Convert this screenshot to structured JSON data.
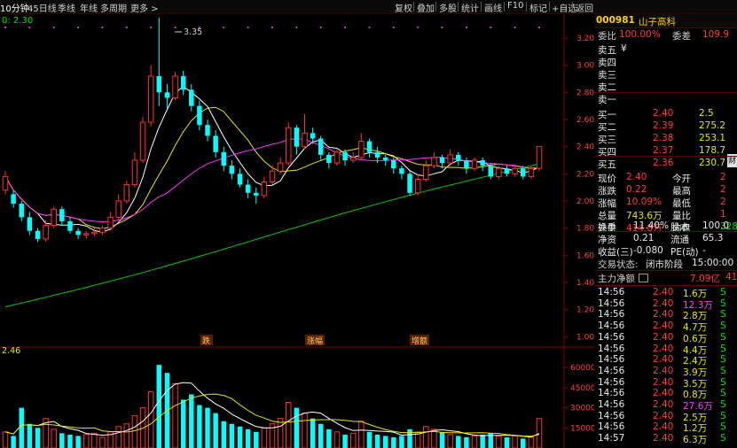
{
  "toolbar": {
    "period_label": "10分钟",
    "items": [
      "45日线",
      "季线",
      "年线",
      "多周期",
      "更多 >"
    ],
    "buttons": [
      "复权",
      "叠加",
      "多股",
      "统计",
      "画线",
      "F10",
      "标记",
      "+自选",
      "返回"
    ]
  },
  "chart": {
    "ma_label": "0: 2.30",
    "peak_label": "3.35",
    "price_ticks": [
      "3.20",
      "3.00",
      "2.80",
      "2.60",
      "2.40",
      "2.20",
      "2.00",
      "1.80",
      "1.60",
      "1.40",
      "1.20",
      "1.00"
    ],
    "volume_label": "2.46",
    "volume_ticks": [
      "60000",
      "45000",
      "30000",
      "15000"
    ],
    "event_tags": [
      "跌",
      "涨幅",
      "增额"
    ]
  },
  "quote": {
    "code": "000981",
    "name": "山子高科",
    "weibi_label": "委比",
    "weibi_value": "100.00%",
    "weicha_label": "委差",
    "weicha_value": "109.9",
    "sell_levels": [
      {
        "label": "卖五",
        "price": "¥",
        "vol": ""
      },
      {
        "label": "卖四",
        "price": "",
        "vol": ""
      },
      {
        "label": "卖三",
        "price": "",
        "vol": ""
      },
      {
        "label": "卖二",
        "price": "",
        "vol": ""
      },
      {
        "label": "卖一",
        "price": "",
        "vol": ""
      }
    ],
    "buy_levels": [
      {
        "label": "买一",
        "price": "2.40",
        "vol": "2.5"
      },
      {
        "label": "买二",
        "price": "2.39",
        "vol": "275.2"
      },
      {
        "label": "买三",
        "price": "2.38",
        "vol": "253.1"
      },
      {
        "label": "买四",
        "price": "2.37",
        "vol": "178.7"
      },
      {
        "label": "买五",
        "price": "2.36",
        "vol": "230.7"
      }
    ],
    "stats": [
      {
        "l1": "现价",
        "v1": "2.40",
        "l2": "今开",
        "v2": "2"
      },
      {
        "l1": "涨跌",
        "v1": "0.22",
        "l2": "最高",
        "v2": "2"
      },
      {
        "l1": "涨幅",
        "v1": "10.09%",
        "l2": "最低",
        "v2": "2"
      },
      {
        "l1": "总量",
        "v1": "743.6万",
        "l2": "量比",
        "v2": "1"
      },
      {
        "l1": "外盘",
        "v1": "414.8万",
        "l2": "内盘",
        "v2": "328.8"
      }
    ],
    "stats2": [
      {
        "l1": "换手",
        "v1": "11.40%",
        "l2": "股本",
        "v2": "100.0"
      },
      {
        "l1": "净资",
        "v1": "0.21",
        "l2": "流通",
        "v2": "65.3"
      },
      {
        "l1": "收益(三)",
        "v1": "-0.080",
        "l2": "PE(动)",
        "v2": "-"
      }
    ],
    "trade_status_label": "交易状态:",
    "trade_status_value": "闭市阶段",
    "trade_time": "15:00:00",
    "main_flow_label": "主力净额",
    "main_flow_value": "7.09亿",
    "main_flow_extra": "41",
    "side_tab": "财",
    "ticks": [
      {
        "time": "14:56",
        "price": "2.40",
        "vol": "1.6万",
        "dir": "S"
      },
      {
        "time": "14:56",
        "price": "2.40",
        "vol": "12.3万",
        "dir": "S"
      },
      {
        "time": "14:56",
        "price": "2.40",
        "vol": "2.8万",
        "dir": "S"
      },
      {
        "time": "14:56",
        "price": "2.40",
        "vol": "4.7万",
        "dir": "S"
      },
      {
        "time": "14:56",
        "price": "2.40",
        "vol": "0.6万",
        "dir": "S"
      },
      {
        "time": "14:56",
        "price": "2.40",
        "vol": "4.4万",
        "dir": "S"
      },
      {
        "time": "14:56",
        "price": "2.40",
        "vol": "2.4万",
        "dir": "S"
      },
      {
        "time": "14:56",
        "price": "2.40",
        "vol": "3.9万",
        "dir": "S"
      },
      {
        "time": "14:56",
        "price": "2.40",
        "vol": "3.5万",
        "dir": "S"
      },
      {
        "time": "14:56",
        "price": "2.40",
        "vol": "0.8万",
        "dir": "S"
      },
      {
        "time": "14:56",
        "price": "2.40",
        "vol": "27.6万",
        "dir": "S"
      },
      {
        "time": "14:56",
        "price": "2.40",
        "vol": "2.5万",
        "dir": "S"
      },
      {
        "time": "14:56",
        "price": "2.40",
        "vol": "1.2万",
        "dir": "S"
      },
      {
        "time": "14:57",
        "price": "2.40",
        "vol": "6.3万",
        "dir": "S"
      }
    ]
  },
  "chart_data": {
    "type": "candlestick",
    "price_range": [
      0.95,
      3.35
    ],
    "candles": [
      [
        2.08,
        2.18,
        2.05,
        2.22
      ],
      [
        2.05,
        1.98,
        1.95,
        2.08
      ],
      [
        1.98,
        1.88,
        1.85,
        2.0
      ],
      [
        1.88,
        1.78,
        1.75,
        1.92
      ],
      [
        1.78,
        1.72,
        1.7,
        1.8
      ],
      [
        1.72,
        1.82,
        1.7,
        1.86
      ],
      [
        1.82,
        1.94,
        1.8,
        1.96
      ],
      [
        1.94,
        1.85,
        1.82,
        1.96
      ],
      [
        1.85,
        1.78,
        1.76,
        1.88
      ],
      [
        1.78,
        1.75,
        1.72,
        1.8
      ],
      [
        1.75,
        1.76,
        1.72,
        1.78
      ],
      [
        1.76,
        1.77,
        1.74,
        1.8
      ],
      [
        1.77,
        1.8,
        1.75,
        1.82
      ],
      [
        1.8,
        1.88,
        1.78,
        1.92
      ],
      [
        1.88,
        2.0,
        1.86,
        2.05
      ],
      [
        2.0,
        2.12,
        1.98,
        2.15
      ],
      [
        2.12,
        2.3,
        2.1,
        2.36
      ],
      [
        2.3,
        2.58,
        2.28,
        2.62
      ],
      [
        2.58,
        2.92,
        2.55,
        3.0
      ],
      [
        2.92,
        2.8,
        2.7,
        3.35
      ],
      [
        2.8,
        2.76,
        2.68,
        2.86
      ],
      [
        2.76,
        2.92,
        2.74,
        2.95
      ],
      [
        2.92,
        2.82,
        2.78,
        2.96
      ],
      [
        2.82,
        2.7,
        2.66,
        2.86
      ],
      [
        2.7,
        2.56,
        2.52,
        2.74
      ],
      [
        2.56,
        2.48,
        2.44,
        2.6
      ],
      [
        2.48,
        2.36,
        2.32,
        2.52
      ],
      [
        2.36,
        2.26,
        2.22,
        2.4
      ],
      [
        2.26,
        2.2,
        2.16,
        2.3
      ],
      [
        2.2,
        2.12,
        2.1,
        2.24
      ],
      [
        2.12,
        2.06,
        2.02,
        2.16
      ],
      [
        2.06,
        2.04,
        1.98,
        2.1
      ],
      [
        2.04,
        2.14,
        2.02,
        2.18
      ],
      [
        2.14,
        2.22,
        2.12,
        2.26
      ],
      [
        2.22,
        2.28,
        2.2,
        2.32
      ],
      [
        2.28,
        2.54,
        2.26,
        2.58
      ],
      [
        2.54,
        2.4,
        2.34,
        2.56
      ],
      [
        2.4,
        2.5,
        2.38,
        2.64
      ],
      [
        2.5,
        2.46,
        2.42,
        2.54
      ],
      [
        2.46,
        2.34,
        2.3,
        2.48
      ],
      [
        2.34,
        2.28,
        2.24,
        2.36
      ],
      [
        2.28,
        2.36,
        2.26,
        2.38
      ],
      [
        2.36,
        2.3,
        2.26,
        2.38
      ],
      [
        2.3,
        2.32,
        2.28,
        2.36
      ],
      [
        2.32,
        2.44,
        2.3,
        2.5
      ],
      [
        2.44,
        2.36,
        2.32,
        2.46
      ],
      [
        2.36,
        2.32,
        2.28,
        2.4
      ],
      [
        2.32,
        2.3,
        2.26,
        2.34
      ],
      [
        2.3,
        2.24,
        2.2,
        2.32
      ],
      [
        2.24,
        2.2,
        2.16,
        2.26
      ],
      [
        2.2,
        2.06,
        2.04,
        2.22
      ],
      [
        2.06,
        2.16,
        2.04,
        2.2
      ],
      [
        2.16,
        2.26,
        2.14,
        2.3
      ],
      [
        2.26,
        2.32,
        2.24,
        2.36
      ],
      [
        2.32,
        2.28,
        2.24,
        2.34
      ],
      [
        2.28,
        2.34,
        2.26,
        2.38
      ],
      [
        2.34,
        2.3,
        2.26,
        2.36
      ],
      [
        2.3,
        2.24,
        2.2,
        2.32
      ],
      [
        2.24,
        2.3,
        2.22,
        2.32
      ],
      [
        2.3,
        2.26,
        2.22,
        2.32
      ],
      [
        2.26,
        2.18,
        2.16,
        2.28
      ],
      [
        2.18,
        2.24,
        2.16,
        2.26
      ],
      [
        2.24,
        2.2,
        2.18,
        2.26
      ],
      [
        2.2,
        2.24,
        2.18,
        2.26
      ],
      [
        2.24,
        2.18,
        2.16,
        2.26
      ],
      [
        2.18,
        2.24,
        2.16,
        2.26
      ],
      [
        2.24,
        2.4,
        2.22,
        2.4
      ]
    ],
    "volumes": [
      12000,
      9000,
      30000,
      18000,
      15000,
      22000,
      14000,
      11000,
      10000,
      9000,
      10000,
      11000,
      8000,
      12000,
      16000,
      18000,
      24000,
      30000,
      42000,
      62000,
      56000,
      48000,
      36000,
      40000,
      32000,
      30000,
      26000,
      20000,
      18000,
      16000,
      14000,
      12000,
      15000,
      18000,
      22000,
      34000,
      30000,
      26000,
      22000,
      18000,
      14000,
      12000,
      10000,
      11000,
      20000,
      12000,
      10000,
      9000,
      8000,
      9000,
      14000,
      12000,
      16000,
      14000,
      12000,
      10000,
      9000,
      8000,
      9000,
      10000,
      11000,
      9000,
      8000,
      9000,
      7000,
      8000,
      22000
    ],
    "volume_range": [
      0,
      70000
    ]
  }
}
